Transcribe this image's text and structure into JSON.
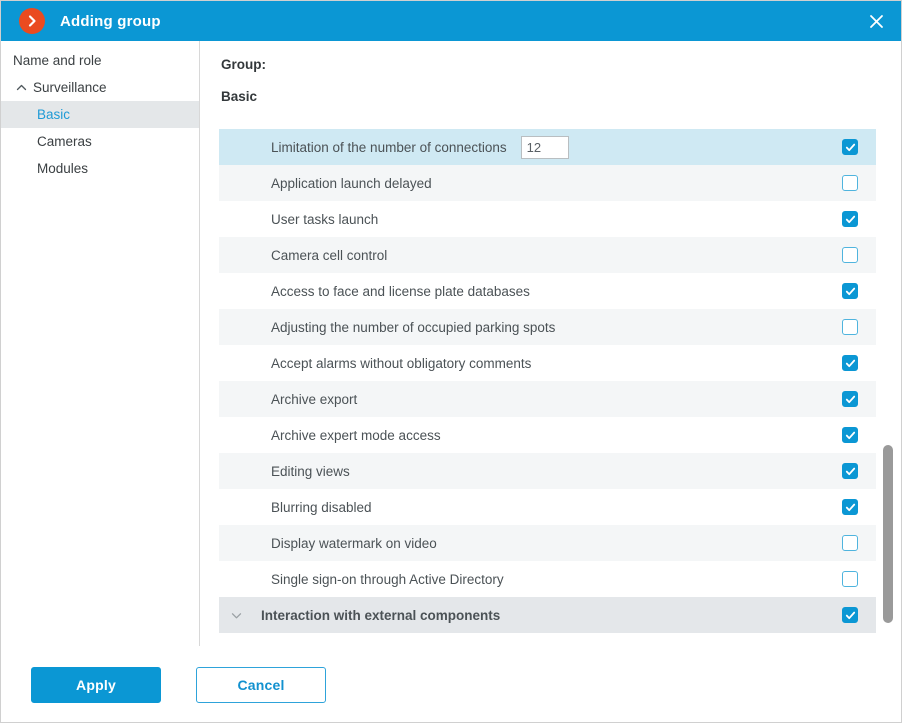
{
  "window": {
    "title": "Adding group",
    "logo_icon": "chevron-right-circle-icon",
    "close_icon": "close-icon",
    "accent_color": "#0b97d4",
    "logo_color": "#ea4b20"
  },
  "sidebar": {
    "items": [
      {
        "label": "Name and role",
        "level": "level0",
        "chevron": "",
        "selected": false
      },
      {
        "label": "Surveillance",
        "level": "group",
        "chevron": "chevron-up-icon",
        "selected": false
      },
      {
        "label": "Basic",
        "level": "child",
        "chevron": "",
        "selected": true
      },
      {
        "label": "Cameras",
        "level": "child",
        "chevron": "",
        "selected": false
      },
      {
        "label": "Modules",
        "level": "child",
        "chevron": "",
        "selected": false
      }
    ]
  },
  "content": {
    "heading_group": "Group:",
    "heading_section": "Basic",
    "rows": [
      {
        "label": "Limitation of the number of connections",
        "checked": true,
        "style": "highlight",
        "input_value": "12",
        "has_input": true,
        "group": false
      },
      {
        "label": "Application launch delayed",
        "checked": false,
        "style": "alt",
        "has_input": false,
        "group": false
      },
      {
        "label": "User tasks launch",
        "checked": true,
        "style": "plain",
        "has_input": false,
        "group": false
      },
      {
        "label": "Camera cell control",
        "checked": false,
        "style": "alt",
        "has_input": false,
        "group": false
      },
      {
        "label": "Access to face and license plate databases",
        "checked": true,
        "style": "plain",
        "has_input": false,
        "group": false
      },
      {
        "label": "Adjusting the number of occupied parking spots",
        "checked": false,
        "style": "alt",
        "has_input": false,
        "group": false
      },
      {
        "label": "Accept alarms without obligatory comments",
        "checked": true,
        "style": "plain",
        "has_input": false,
        "group": false
      },
      {
        "label": "Archive export",
        "checked": true,
        "style": "alt",
        "has_input": false,
        "group": false
      },
      {
        "label": "Archive expert mode access",
        "checked": true,
        "style": "plain",
        "has_input": false,
        "group": false
      },
      {
        "label": "Editing views",
        "checked": true,
        "style": "alt",
        "has_input": false,
        "group": false
      },
      {
        "label": "Blurring disabled",
        "checked": true,
        "style": "plain",
        "has_input": false,
        "group": false
      },
      {
        "label": "Display watermark on video",
        "checked": false,
        "style": "alt",
        "has_input": false,
        "group": false
      },
      {
        "label": "Single sign-on through Active Directory",
        "checked": false,
        "style": "plain",
        "has_input": false,
        "group": false
      },
      {
        "label": "Interaction with external components",
        "checked": true,
        "style": "grouprow",
        "has_input": false,
        "group": true,
        "chevron": "chevron-down-icon"
      }
    ]
  },
  "scrollbar": {
    "icon": "vertical-scrollbar"
  },
  "footer": {
    "apply_label": "Apply",
    "cancel_label": "Cancel"
  }
}
